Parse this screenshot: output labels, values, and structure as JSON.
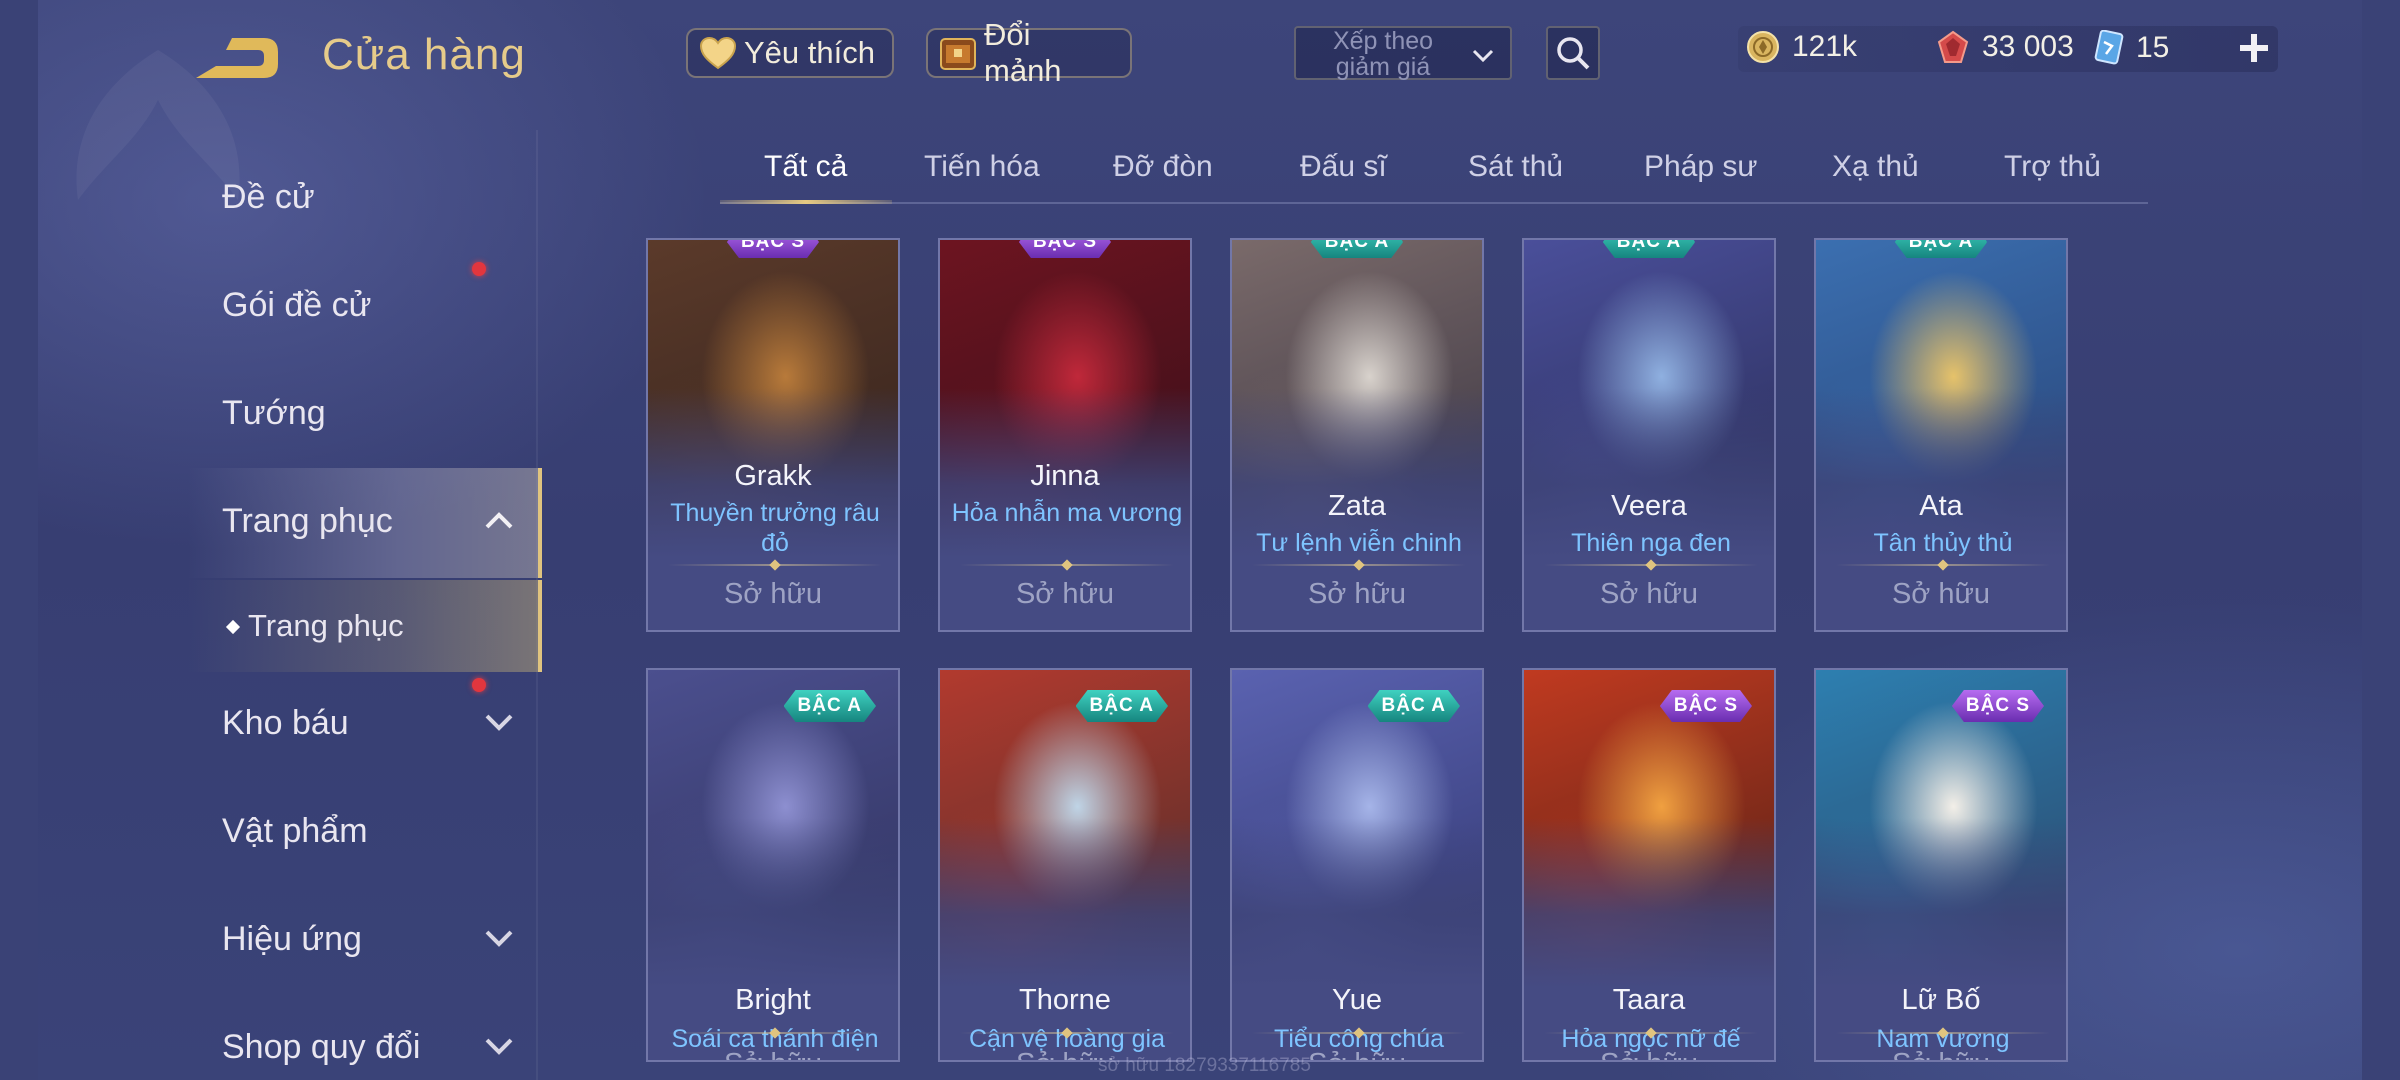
{
  "header": {
    "title": "Cửa hàng",
    "favorite_label": "Yêu thích",
    "exchange_label": "Đổi mảnh",
    "sort_label": "Xếp theo giảm giá",
    "currencies": [
      {
        "icon": "gold-coin-icon",
        "value": "121k"
      },
      {
        "icon": "ruby-icon",
        "value": "33 003"
      },
      {
        "icon": "voucher-card-icon",
        "value": "15"
      }
    ]
  },
  "sidebar": {
    "items": [
      {
        "label": "Đề cử"
      },
      {
        "label": "Gói đề cử"
      },
      {
        "label": "Tướng"
      },
      {
        "label": "Trang phục"
      },
      {
        "label": "Trang phục"
      },
      {
        "label": "Kho báu"
      },
      {
        "label": "Vật phẩm"
      },
      {
        "label": "Hiệu ứng"
      },
      {
        "label": "Shop quy đổi"
      }
    ]
  },
  "tabs": [
    "Tất cả",
    "Tiến hóa",
    "Đỡ đòn",
    "Đấu sĩ",
    "Sát thủ",
    "Pháp sư",
    "Xạ thủ",
    "Trợ thủ"
  ],
  "cards_row1": [
    {
      "hero": "Grakk",
      "skin": "Thuyền trưởng râu đỏ",
      "status": "Sở hữu",
      "tier": "BẬC S",
      "palette": [
        "#b87a3a",
        "#5b3a2a",
        "#2a1d1a"
      ]
    },
    {
      "hero": "Jinna",
      "skin": "Hỏa nhẫn ma vương",
      "status": "Sở hữu",
      "tier": "BẬC S",
      "palette": [
        "#c0283a",
        "#6d1420",
        "#2a0e18"
      ]
    },
    {
      "hero": "Zata",
      "skin": "Tư lệnh viễn chinh",
      "status": "Sở hữu",
      "tier": "BẬC A",
      "palette": [
        "#d8d2cc",
        "#7a6a6a",
        "#2d2a3a"
      ]
    },
    {
      "hero": "Veera",
      "skin": "Thiên nga đen",
      "status": "Sở hữu",
      "tier": "BẬC A",
      "palette": [
        "#8fb0e0",
        "#4a4f9a",
        "#23264a"
      ]
    },
    {
      "hero": "Ata",
      "skin": "Tân thủy thủ",
      "status": "Sở hữu",
      "tier": "BẬC A",
      "palette": [
        "#e6c26a",
        "#3b6fb0",
        "#243a6a"
      ]
    }
  ],
  "cards_row2": [
    {
      "hero": "Bright",
      "skin": "Soái ca thánh điện",
      "status": "Sở hữu",
      "tier": "BẬC A",
      "palette": [
        "#8d8fd0",
        "#4b4f8e",
        "#2b2d55"
      ]
    },
    {
      "hero": "Thorne",
      "skin": "Cận vệ hoàng gia",
      "status": "Sở hữu",
      "tier": "BẬC A",
      "palette": [
        "#bfd4e6",
        "#b23a2e",
        "#3a2a2a"
      ]
    },
    {
      "hero": "Yue",
      "skin": "Tiểu công chúa",
      "status": "Sở hữu",
      "tier": "BẬC A",
      "palette": [
        "#a5b4e8",
        "#5a62b0",
        "#2c3168"
      ]
    },
    {
      "hero": "Taara",
      "skin": "Hỏa ngọc nữ đế",
      "status": "Sở hữu",
      "tier": "BẬC S",
      "palette": [
        "#f0a040",
        "#c03a20",
        "#3a1a14"
      ]
    },
    {
      "hero": "Lữ Bố",
      "skin": "Nam vương",
      "status": "Sở hữu",
      "tier": "BẬC S",
      "palette": [
        "#f3efe8",
        "#2d7fb0",
        "#2a3a5a"
      ]
    }
  ],
  "watermark": "sở hữu 18279337116785"
}
